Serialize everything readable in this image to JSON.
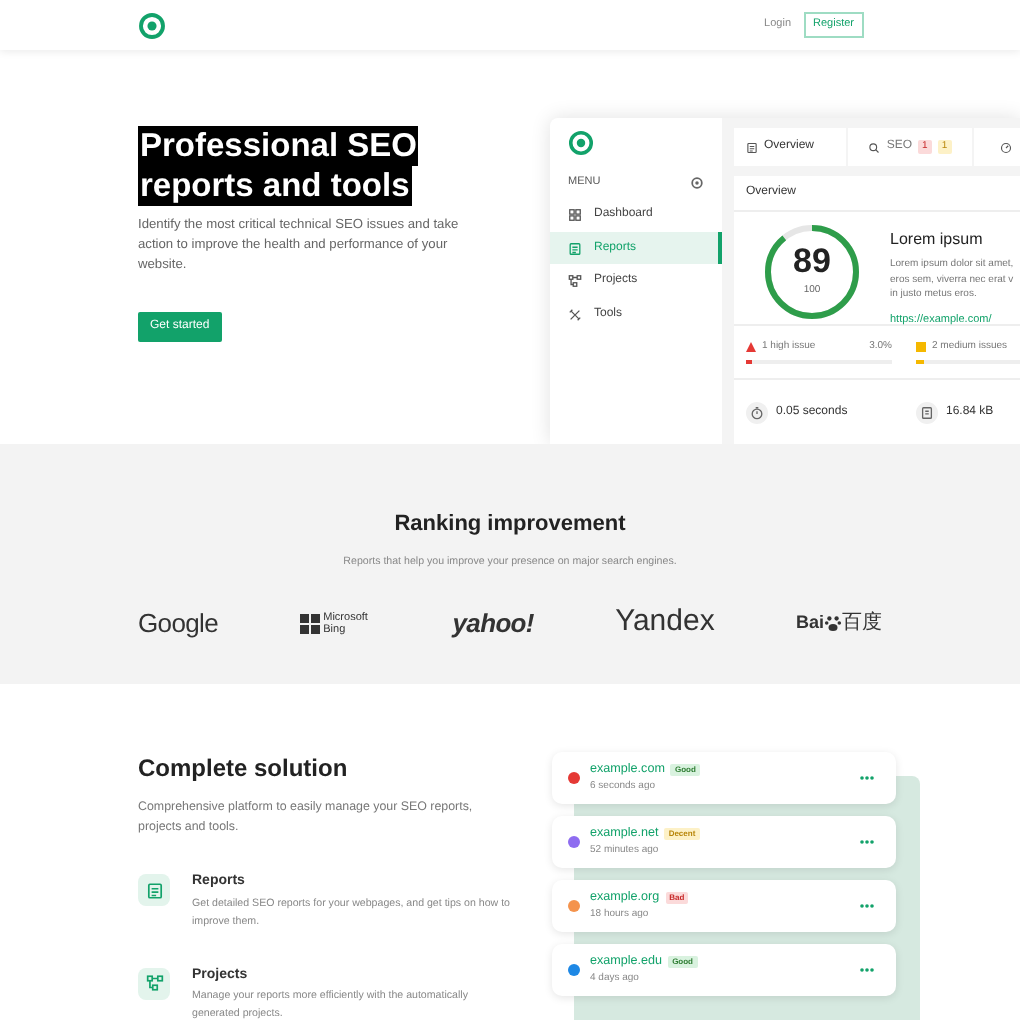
{
  "header": {
    "login": "Login",
    "register": "Register"
  },
  "hero": {
    "title_lines": [
      "Professional SEO",
      "reports and tools"
    ],
    "text": "Identify the most critical technical SEO issues and take action to improve the health and performance of your website.",
    "button": "Get started"
  },
  "mockup": {
    "menu_label": "MENU",
    "menu": [
      {
        "label": "Dashboard",
        "selected": false
      },
      {
        "label": "Reports",
        "selected": true
      },
      {
        "label": "Projects",
        "selected": false
      },
      {
        "label": "Tools",
        "selected": false
      }
    ],
    "tabs": [
      {
        "label": "Overview",
        "selected": true
      },
      {
        "label": "SEO",
        "selected": false,
        "badges": [
          {
            "text": "1",
            "kind": "bad"
          },
          {
            "text": "1",
            "kind": "decent"
          }
        ]
      },
      {
        "selected": false
      }
    ],
    "card_title": "Overview",
    "score": {
      "value": "89",
      "max": "100",
      "level": 0.89
    },
    "site": {
      "title": "Lorem ipsum",
      "lines": [
        "Lorem ipsum dolor sit amet,",
        "eros sem, viverra nec erat v",
        "in justo metus eros."
      ],
      "url": "https://example.com/"
    },
    "issues": [
      {
        "label": "1 high issue",
        "value": "3.0%",
        "kind": "bad",
        "level": 0.03
      },
      {
        "label": "2 medium issues",
        "kind": "decent",
        "level": 0.05
      }
    ],
    "stats": [
      {
        "label": "0.05 seconds"
      },
      {
        "label": "16.84 kB"
      }
    ]
  },
  "ranking": {
    "title": "Ranking improvement",
    "subtitle": "Reports that help you improve your presence on major search engines.",
    "logos": [
      {
        "kind": "google",
        "text": "Google"
      },
      {
        "kind": "bing",
        "text": "Microsoft",
        "text2": "Bing"
      },
      {
        "kind": "yahoo",
        "text": "yahoo!"
      },
      {
        "kind": "yandex",
        "text": "Yandex"
      },
      {
        "kind": "baidu",
        "text": "Bai",
        "text2": "百度"
      }
    ]
  },
  "solution": {
    "title": "Complete solution",
    "text": "Comprehensive platform to easily manage your SEO reports, projects and tools.",
    "features": [
      {
        "title": "Reports",
        "text": "Get detailed SEO reports for your webpages, and get tips on how to improve them."
      },
      {
        "title": "Projects",
        "text": "Manage your reports more efficiently with the automatically generated projects."
      }
    ],
    "sites": [
      {
        "domain": "example.com",
        "time": "6 seconds ago",
        "status": "Good",
        "kind": "good",
        "color": "#e53935"
      },
      {
        "domain": "example.net",
        "time": "52 minutes ago",
        "status": "Decent",
        "kind": "decent",
        "color": "#8e6cf0"
      },
      {
        "domain": "example.org",
        "time": "18 hours ago",
        "status": "Bad",
        "kind": "bad",
        "color": "#f4934d"
      },
      {
        "domain": "example.edu",
        "time": "4 days ago",
        "status": "Good",
        "kind": "good",
        "color": "#1e88e5"
      }
    ]
  }
}
